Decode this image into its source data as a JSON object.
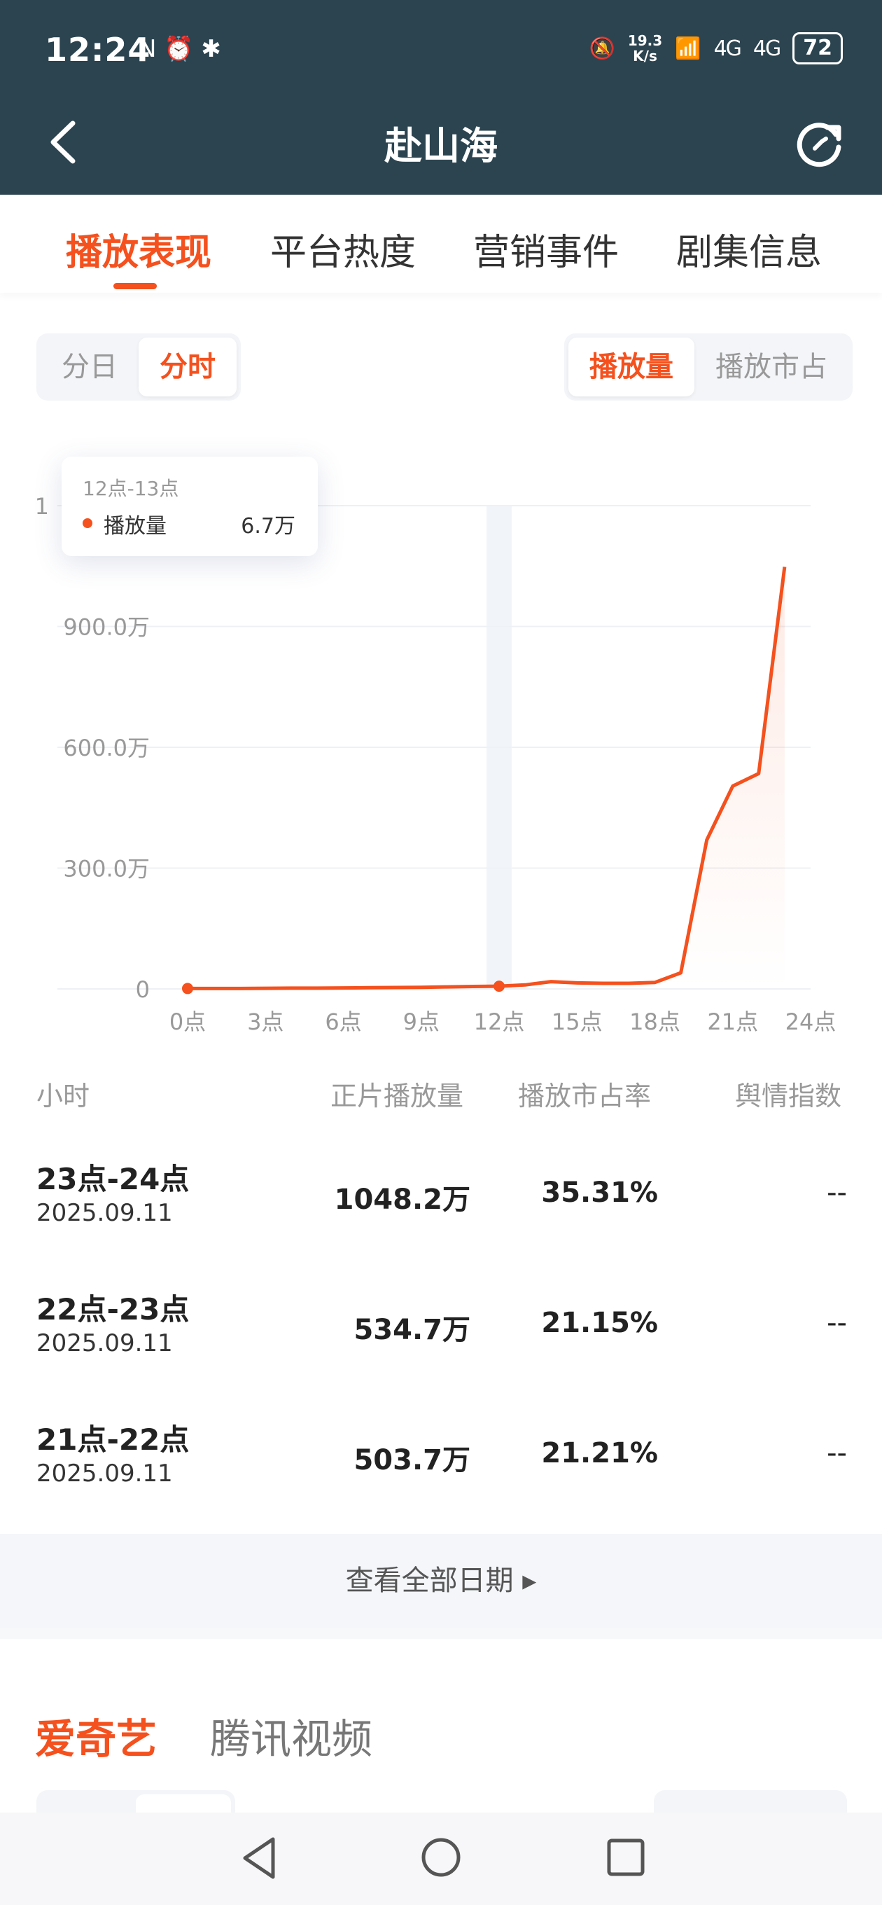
{
  "status_bar": {
    "time": "12:24",
    "left_icons": "N ⏰ ✱",
    "speed_top": "19.3",
    "speed_unit": "K/s",
    "signal_1": "4G",
    "signal_2": "4G",
    "battery": "72"
  },
  "header": {
    "title": "赴山海",
    "back_icon": "chevron-left-icon",
    "refresh_icon": "refresh-icon"
  },
  "tabs": [
    {
      "label": "播放表现",
      "active": true
    },
    {
      "label": "平台热度",
      "active": false
    },
    {
      "label": "营销事件",
      "active": false
    },
    {
      "label": "剧集信息",
      "active": false
    }
  ],
  "time_toggle": {
    "options": [
      "分日",
      "分时"
    ],
    "selected": "分时"
  },
  "metric_toggle": {
    "options": [
      "播放量",
      "播放市占"
    ],
    "selected": "播放量"
  },
  "tooltip": {
    "title": "12点-13点",
    "label": "播放量",
    "value": "6.7万"
  },
  "chart_data": {
    "type": "line",
    "x_ticks": [
      "0点",
      "3点",
      "6点",
      "9点",
      "12点",
      "15点",
      "18点",
      "21点",
      "24点"
    ],
    "y_ticks": [
      "0",
      "300.0万",
      "600.0万",
      "900.0万",
      "1"
    ],
    "ylim": [
      0,
      1200
    ],
    "x": [
      0,
      1,
      2,
      3,
      4,
      5,
      6,
      7,
      8,
      9,
      10,
      11,
      12,
      13,
      14,
      15,
      16,
      17,
      18,
      19,
      20,
      21,
      22,
      23
    ],
    "series": [
      {
        "values": [
          1,
          1,
          1,
          1.5,
          2,
          2,
          2.5,
          3,
          3.5,
          4,
          5,
          6,
          6.7,
          10,
          18,
          15,
          14,
          14,
          16,
          40,
          370,
          503.7,
          534.7,
          1048.2
        ]
      }
    ],
    "highlight_x": 12,
    "line_color": "#f4511e",
    "grid": true
  },
  "table": {
    "headers": [
      "小时",
      "正片播放量",
      "播放市占率",
      "舆情指数"
    ],
    "rows": [
      {
        "hour": "23点-24点",
        "date": "2025.09.11",
        "play": "1048.2万",
        "share": "35.31%",
        "sentiment": "--"
      },
      {
        "hour": "22点-23点",
        "date": "2025.09.11",
        "play": "534.7万",
        "share": "21.15%",
        "sentiment": "--"
      },
      {
        "hour": "21点-22点",
        "date": "2025.09.11",
        "play": "503.7万",
        "share": "21.21%",
        "sentiment": "--"
      }
    ]
  },
  "view_all": "查看全部日期 ▸",
  "platforms": [
    {
      "label": "爱奇艺",
      "active": true
    },
    {
      "label": "腾讯视频",
      "active": false
    }
  ],
  "colors": {
    "accent": "#f4511e",
    "header_bg": "#2b4450"
  }
}
